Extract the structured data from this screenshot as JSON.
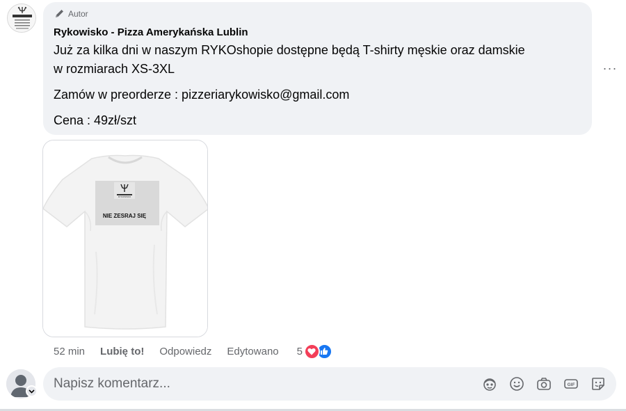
{
  "post": {
    "badge_label": "Autor",
    "author_name": "Rykowisko - Pizza Amerykańska Lublin",
    "line1": "Już za kilka dni w naszym RYKOshopie dostępne będą T-shirty męskie oraz damskie",
    "line2": "w rozmiarach XS-3XL",
    "line3": "Zamów w preorderze : pizzeriarykowisko@gmail.com",
    "line4": "Cena : 49zł/szt",
    "more_label": "···"
  },
  "attachment": {
    "shirt_print_text": "NIE ZESRAJ SIĘ",
    "shirt_logo_text": "RYKOWISKO",
    "icon": "tshirt-photo"
  },
  "actions": {
    "time": "52 min",
    "like_label": "Lubię to!",
    "reply_label": "Odpowiedz",
    "edited_label": "Edytowano",
    "reaction_count": "5",
    "reaction_icons": [
      "love-icon",
      "like-icon"
    ]
  },
  "composer": {
    "placeholder": "Napisz komentarz...",
    "tools": [
      "avatar-sticker-icon",
      "emoji-icon",
      "camera-icon",
      "gif-icon",
      "sticker-icon"
    ]
  },
  "colors": {
    "bubble": "#f0f2f5",
    "secondary_text": "#65676b",
    "love": "#f33e58",
    "like": "#1877f2"
  }
}
